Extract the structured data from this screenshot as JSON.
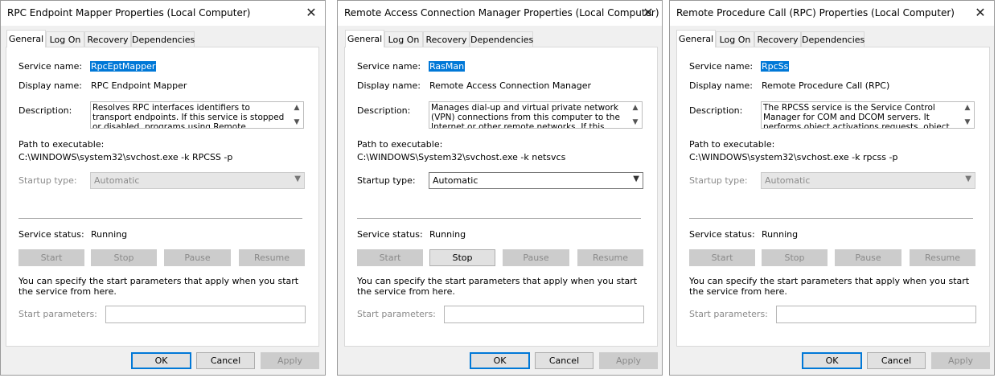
{
  "tabs": [
    "General",
    "Log On",
    "Recovery",
    "Dependencies"
  ],
  "labels": {
    "service_name": "Service name:",
    "display_name": "Display name:",
    "description": "Description:",
    "path": "Path to executable:",
    "startup_type": "Startup type:",
    "service_status": "Service status:",
    "hint": "You can specify the start parameters that apply when you start the service from here.",
    "start_params": "Start parameters:"
  },
  "buttons": {
    "start": "Start",
    "stop": "Stop",
    "pause": "Pause",
    "resume": "Resume",
    "ok": "OK",
    "cancel": "Cancel",
    "apply": "Apply"
  },
  "icons": {
    "close": "close-icon",
    "scroll_up": "chevron-up-icon",
    "scroll_down": "chevron-down-icon",
    "dropdown": "chevron-down-icon"
  },
  "colors": {
    "selection": "#0078d7",
    "default_button_border": "#0078d7",
    "dialog_bg": "#f0f0f0"
  },
  "dialogs": [
    {
      "title": "RPC Endpoint Mapper Properties (Local Computer)",
      "service_name": "RpcEptMapper",
      "display_name": "RPC Endpoint Mapper",
      "description": "Resolves RPC interfaces identifiers to transport endpoints. If this service is stopped or disabled, programs using Remote Procedure Call (RPC)",
      "path": "C:\\WINDOWS\\system32\\svchost.exe -k RPCSS -p",
      "startup_type": "Automatic",
      "status": "Running",
      "start_params_value": ""
    },
    {
      "title": "Remote Access Connection Manager Properties (Local Computer)",
      "service_name": "RasMan",
      "display_name": "Remote Access Connection Manager",
      "description": "Manages dial-up and virtual private network (VPN) connections from this computer to the Internet or other remote networks. If this service is disabled, any",
      "path": "C:\\WINDOWS\\System32\\svchost.exe -k netsvcs",
      "startup_type": "Automatic",
      "status": "Running",
      "start_params_value": ""
    },
    {
      "title": "Remote Procedure Call (RPC) Properties (Local Computer)",
      "service_name": "RpcSs",
      "display_name": "Remote Procedure Call (RPC)",
      "description": "The RPCSS service is the Service Control Manager for COM and DCOM servers. It performs object activations requests, object exporter resolutions and",
      "path": "C:\\WINDOWS\\system32\\svchost.exe -k rpcss -p",
      "startup_type": "Automatic",
      "status": "Running",
      "start_params_value": ""
    }
  ]
}
